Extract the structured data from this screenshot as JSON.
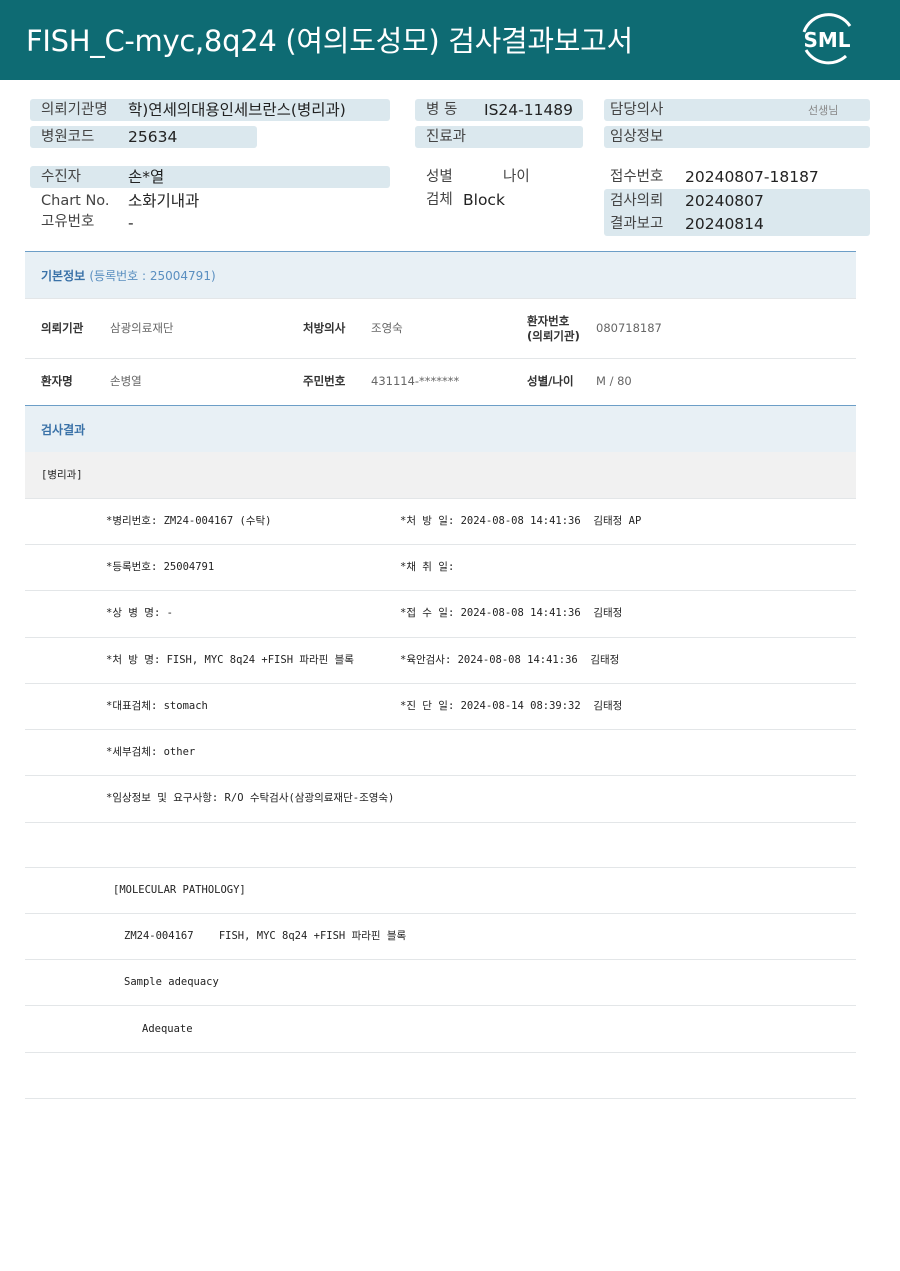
{
  "header": {
    "title": "FISH_C-myc,8q24 (여의도성모) 검사결과보고서",
    "logo_text": "SML",
    "brand_color": "#0e6b73"
  },
  "summary": {
    "institution_label": "의뢰기관명",
    "institution_value": "학)연세의대용인세브란스(병리과)",
    "ward_label": "병 동",
    "ward_value": "IS24-11489",
    "doctor_label": "담당의사",
    "doctor_suffix": "선생님",
    "hospital_code_label": "병원코드",
    "hospital_code_value": "25634",
    "department_label": "진료과",
    "clinical_info_label": "임상정보",
    "patient_label": "수진자",
    "patient_value": "손*열",
    "sex_label": "성별",
    "age_label": "나이",
    "receipt_no_label": "접수번호",
    "receipt_no_value": "20240807-18187",
    "chart_label": "Chart No.",
    "chart_value": "소화기내과",
    "specimen_label": "검체",
    "specimen_value": "Block",
    "request_label": "검사의뢰",
    "request_value": "20240807",
    "unique_no_label": "고유번호",
    "unique_no_value": "-",
    "report_label": "결과보고",
    "report_value": "20240814"
  },
  "basic_info": {
    "section_title": "기본정보",
    "registration_sub": "(등록번호 : 25004791)",
    "row1": {
      "requester_label": "의뢰기관",
      "requester_value": "삼광의료재단",
      "prescriber_label": "처방의사",
      "prescriber_value": "조영숙",
      "patient_no_label_1": "환자번호",
      "patient_no_label_2": "(의뢰기관)",
      "patient_no_value": "080718187"
    },
    "row2": {
      "patient_name_label": "환자명",
      "patient_name_value": "손병열",
      "resident_no_label": "주민번호",
      "resident_no_value": "431114-*******",
      "sex_age_label": "성별/나이",
      "sex_age_value": "M / 80"
    }
  },
  "results": {
    "section_title": "검사결과",
    "dept_header": "[병리과]",
    "lines": [
      {
        "left": "*병리번호: ZM24-004167 (수탁)",
        "right": "*처 방 일: 2024-08-08 14:41:36  김태정 AP"
      },
      {
        "left": "*등록번호: 25004791",
        "right": "*채 취 일:"
      },
      {
        "left": "*상 병 명: -",
        "right": "*접 수 일: 2024-08-08 14:41:36  김태정"
      },
      {
        "left": "*처 방 명: FISH, MYC 8q24 +FISH 파라핀 블록",
        "right": "*육안검사: 2024-08-08 14:41:36  김태정"
      },
      {
        "left": "*대표검체: stomach",
        "right": "*진 단 일: 2024-08-14 08:39:32  김태정"
      },
      {
        "left": "*세부검체: other",
        "right": ""
      },
      {
        "left": "*임상정보 및 요구사항: R/O 수탁검사(삼광의료재단-조영숙)",
        "right": ""
      }
    ],
    "molecular_header": "[MOLECULAR PATHOLOGY]",
    "molecular_line": "ZM24-004167    FISH, MYC 8q24 +FISH 파라핀 블록",
    "adequacy_label": "Sample adequacy",
    "adequacy_value": "Adequate"
  }
}
